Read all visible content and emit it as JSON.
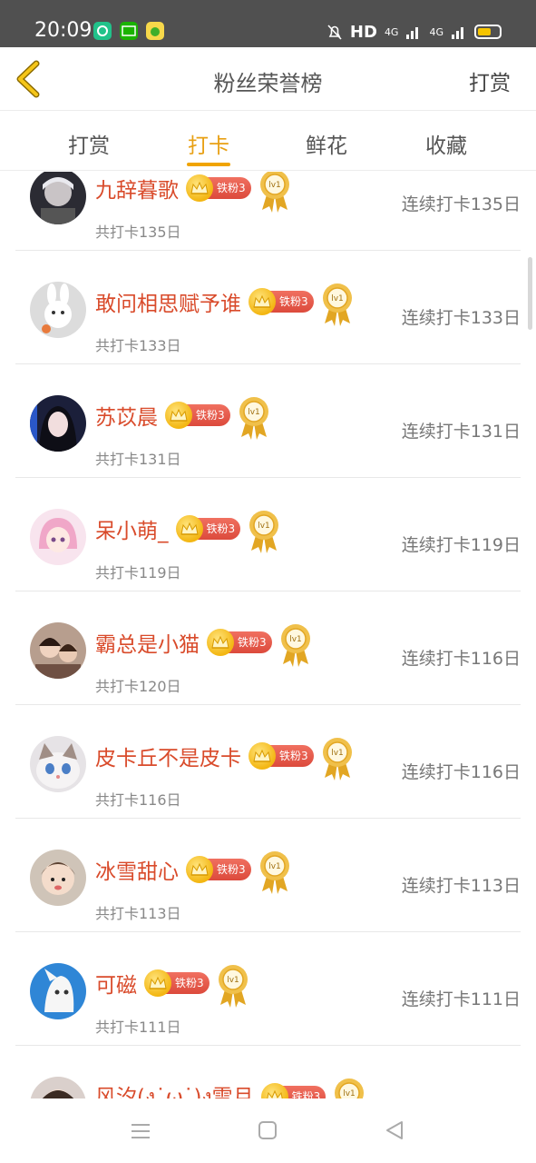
{
  "status_bar": {
    "time": "20:09",
    "network": "HD",
    "signal_1": "4G",
    "signal_2": "4G"
  },
  "header": {
    "title": "粉丝荣誉榜",
    "right_action": "打赏"
  },
  "tabs": [
    {
      "label": "打赏",
      "active": false
    },
    {
      "label": "打卡",
      "active": true
    },
    {
      "label": "鲜花",
      "active": false
    },
    {
      "label": "收藏",
      "active": false
    }
  ],
  "badge": {
    "fan_level": "铁粉3",
    "medal_level": "lv1"
  },
  "rows": [
    {
      "name": "九辞暮歌",
      "total": "共打卡135日",
      "streak": "连续打卡135日",
      "avatar": "avatar-gray-boy"
    },
    {
      "name": "敢问相思赋予谁",
      "total": "共打卡133日",
      "streak": "连续打卡133日",
      "avatar": "avatar-bunny"
    },
    {
      "name": "苏苡晨",
      "total": "共打卡131日",
      "streak": "连续打卡131日",
      "avatar": "avatar-dark-girl"
    },
    {
      "name": "呆小萌_",
      "total": "共打卡119日",
      "streak": "连续打卡119日",
      "avatar": "avatar-pink-anime"
    },
    {
      "name": "霸总是小猫",
      "total": "共打卡120日",
      "streak": "连续打卡116日",
      "avatar": "avatar-couple"
    },
    {
      "name": "皮卡丘不是皮卡",
      "total": "共打卡116日",
      "streak": "连续打卡116日",
      "avatar": "avatar-cat"
    },
    {
      "name": "冰雪甜心",
      "total": "共打卡113日",
      "streak": "连续打卡113日",
      "avatar": "avatar-baby"
    },
    {
      "name": "可磁",
      "total": "共打卡111日",
      "streak": "连续打卡111日",
      "avatar": "avatar-blue-cartoon"
    },
    {
      "name": "风汐(ง˙ω˙)ง雪月",
      "total": "",
      "streak": "",
      "avatar": "avatar-partial"
    }
  ],
  "colors": {
    "accent": "#f0a400",
    "username": "#d94b2b",
    "fan_tag": "#dc4a3c"
  }
}
